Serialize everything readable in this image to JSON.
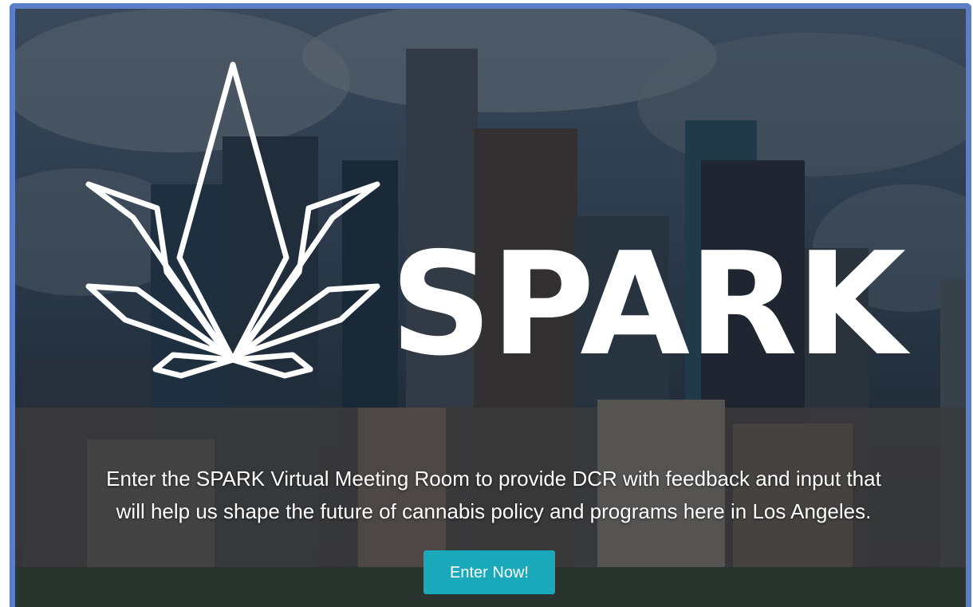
{
  "hero": {
    "brand": "SPARK",
    "tagline_line1": "Enter the SPARK Virtual Meeting Room to provide DCR with feedback and input that",
    "tagline_line2": "will help us shape the future of cannabis policy and programs here in Los Angeles.",
    "cta_label": "Enter Now!"
  },
  "colors": {
    "frame_border": "#5b7ec9",
    "cta_background": "#1aa9ba",
    "text": "#ffffff"
  },
  "icons": {
    "logo": "cannabis-leaf-outline-icon",
    "background": "city-skyline-photo"
  }
}
